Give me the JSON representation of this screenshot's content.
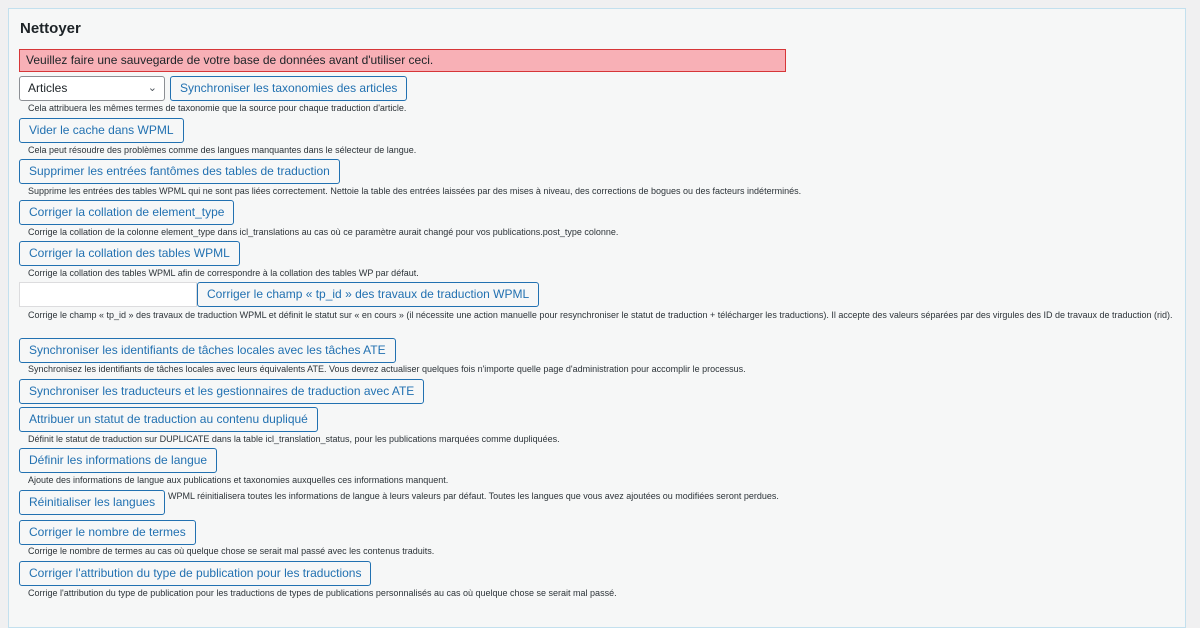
{
  "section": {
    "title": "Nettoyer",
    "warning": "Veuillez faire une sauvegarde de votre base de données avant d'utiliser ceci."
  },
  "post_type_select": {
    "value": "Articles"
  },
  "tp_id_input": {
    "value": ""
  },
  "actions": [
    {
      "label": "Synchroniser les taxonomies des articles",
      "desc": "Cela attribuera les mêmes termes de taxonomie que la source pour chaque traduction d'article."
    },
    {
      "label": "Vider le cache dans WPML",
      "desc": "Cela peut résoudre des problèmes comme des langues manquantes dans le sélecteur de langue."
    },
    {
      "label": "Supprimer les entrées fantômes des tables de traduction",
      "desc": "Supprime les entrées des tables WPML qui ne sont pas liées correctement. Nettoie la table des entrées laissées par des mises à niveau, des corrections de bogues ou des facteurs indéterminés."
    },
    {
      "label": "Corriger la collation de element_type",
      "desc": "Corrige la collation de la colonne element_type dans icl_translations au cas où ce paramètre aurait changé pour vos publications.post_type colonne."
    },
    {
      "label": "Corriger la collation des tables WPML",
      "desc": "Corrige la collation des tables WPML afin de correspondre à la collation des tables WP par défaut."
    },
    {
      "label": "Corriger le champ « tp_id » des travaux de traduction WPML",
      "desc": "Corrige le champ « tp_id » des travaux de traduction WPML et définit le statut sur « en cours » (il nécessite une action manuelle pour resynchroniser le statut de traduction + télécharger les traductions). Il accepte des valeurs séparées par des virgules des ID de travaux de traduction (rid)."
    },
    {
      "label": "Synchroniser les identifiants de tâches locales avec les tâches ATE",
      "desc": "Synchronisez les identifiants de tâches locales avec leurs équivalents ATE. Vous devrez actualiser quelques fois n'importe quelle page d'administration pour accomplir le processus."
    },
    {
      "label": "Synchroniser les traducteurs et les gestionnaires de traduction avec ATE",
      "desc": ""
    },
    {
      "label": "Attribuer un statut de traduction au contenu dupliqué",
      "desc": "Définit le statut de traduction sur DUPLICATE dans la table icl_translation_status, pour les publications marquées comme dupliquées."
    },
    {
      "label": "Définir les informations de langue",
      "desc": "Ajoute des informations de langue aux publications et taxonomies auxquelles ces informations manquent."
    },
    {
      "label": "Réinitialiser les langues",
      "desc": "WPML réinitialisera toutes les informations de langue à leurs valeurs par défaut. Toutes les langues que vous avez ajoutées ou modifiées seront perdues."
    },
    {
      "label": "Corriger le nombre de termes",
      "desc": "Corrige le nombre de termes au cas où quelque chose se serait mal passé avec les contenus traduits."
    },
    {
      "label": "Corriger l'attribution du type de publication pour les traductions",
      "desc": "Corrige l'attribution du type de publication pour les traductions de types de publications personnalisés au cas où quelque chose se serait mal passé."
    }
  ]
}
